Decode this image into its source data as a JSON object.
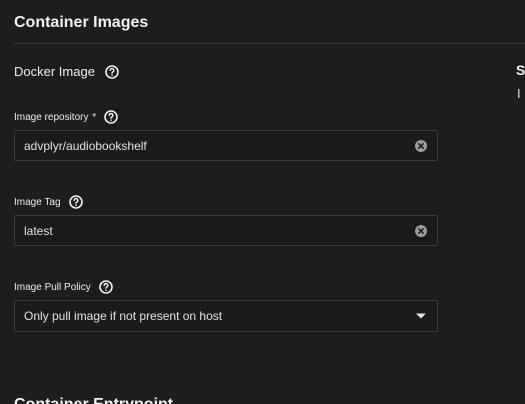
{
  "section": {
    "title": "Container Images",
    "subheading": "Docker Image"
  },
  "fields": {
    "repository": {
      "label": "Image repository",
      "required_mark": "*",
      "value": "advplyr/audiobookshelf"
    },
    "tag": {
      "label": "Image Tag",
      "value": "latest"
    },
    "pull_policy": {
      "label": "Image Pull Policy",
      "selected": "Only pull image if not present on host"
    }
  },
  "side_panel": {
    "heading_fragment": "S",
    "text_fragment": "I"
  },
  "next_section": {
    "title": "Container Entrypoint"
  },
  "icons": {
    "help": "help-circle-icon",
    "clear": "clear-circle-icon",
    "dropdown": "caret-down-icon"
  },
  "colors": {
    "background": "#1d1d1d",
    "input_border": "#3c3c3c",
    "text": "#e6e6e6"
  }
}
